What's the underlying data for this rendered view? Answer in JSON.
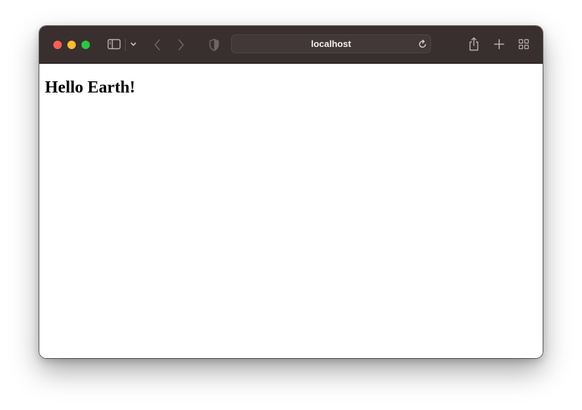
{
  "browser": {
    "address": "localhost",
    "colors": {
      "toolbar": "#392f2f",
      "traffic_close": "#fe5f57",
      "traffic_minimize": "#febc2e",
      "traffic_maximize": "#28c840"
    },
    "icons": {
      "sidebar": "sidebar-icon",
      "chevron": "chevron-down-icon",
      "back": "chevron-left-icon",
      "forward": "chevron-right-icon",
      "privacy": "shield-icon",
      "reload": "reload-icon",
      "share": "share-icon",
      "new_tab": "plus-icon",
      "tab_overview": "grid-icon"
    }
  },
  "page": {
    "heading": "Hello Earth!"
  }
}
